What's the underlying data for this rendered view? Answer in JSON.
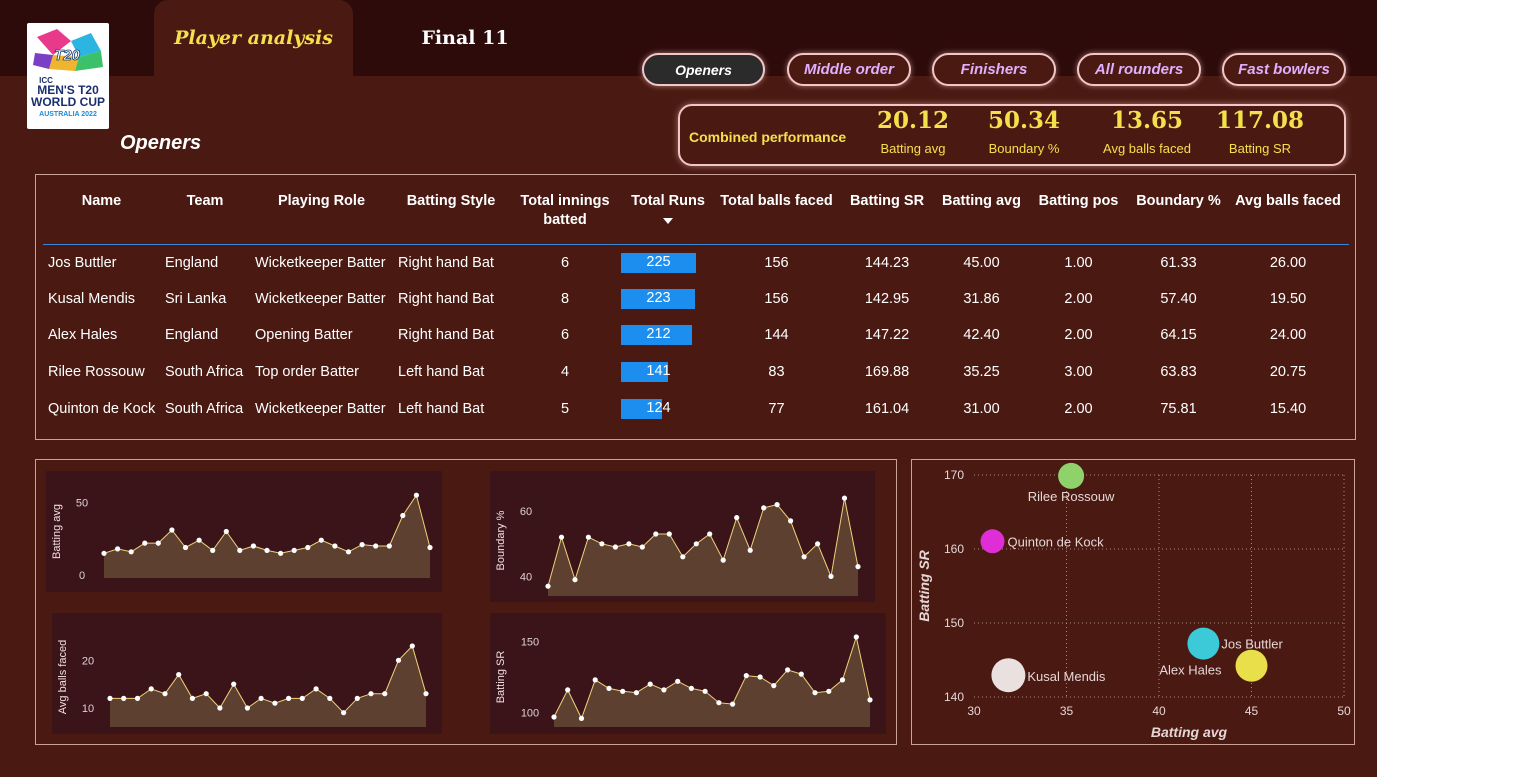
{
  "logo": {
    "line1": "ICC",
    "line2": "MEN'S T20",
    "line3": "WORLD CUP",
    "line4": "AUSTRALIA 2022",
    "mark": "T20"
  },
  "tabs": [
    {
      "label": "Player analysis",
      "active": true
    },
    {
      "label": "Final 11",
      "active": false
    }
  ],
  "role_buttons": [
    {
      "label": "Openers",
      "active": true
    },
    {
      "label": "Middle order",
      "active": false
    },
    {
      "label": "Finishers",
      "active": false
    },
    {
      "label": "All rounders",
      "active": false
    },
    {
      "label": "Fast bowlers",
      "active": false
    }
  ],
  "page_heading": "Openers",
  "combined": {
    "label": "Combined performance",
    "kpis": [
      {
        "value": "20.12",
        "name": "Batting avg"
      },
      {
        "value": "50.34",
        "name": "Boundary %"
      },
      {
        "value": "13.65",
        "name": "Avg balls faced"
      },
      {
        "value": "117.08",
        "name": "Batting SR"
      }
    ]
  },
  "table": {
    "columns": [
      "Name",
      "Team",
      "Playing Role",
      "Batting Style",
      "Total innings batted",
      "Total Runs",
      "Total balls faced",
      "Batting SR",
      "Batting avg",
      "Batting pos",
      "Boundary %",
      "Avg balls faced"
    ],
    "sorted_by": "Total Runs",
    "rows": [
      {
        "name": "Jos Buttler",
        "team": "England",
        "role": "Wicketkeeper Batter",
        "style": "Right hand Bat",
        "innings": "6",
        "runs": "225",
        "runs_value": 225,
        "balls": "156",
        "sr": "144.23",
        "avg": "45.00",
        "pos": "1.00",
        "boundary": "61.33",
        "abf": "26.00"
      },
      {
        "name": "Kusal Mendis",
        "team": "Sri Lanka",
        "role": "Wicketkeeper Batter",
        "style": "Right hand Bat",
        "innings": "8",
        "runs": "223",
        "runs_value": 223,
        "balls": "156",
        "sr": "142.95",
        "avg": "31.86",
        "pos": "2.00",
        "boundary": "57.40",
        "abf": "19.50"
      },
      {
        "name": "Alex Hales",
        "team": "England",
        "role": "Opening Batter",
        "style": "Right hand Bat",
        "innings": "6",
        "runs": "212",
        "runs_value": 212,
        "balls": "144",
        "sr": "147.22",
        "avg": "42.40",
        "pos": "2.00",
        "boundary": "64.15",
        "abf": "24.00"
      },
      {
        "name": "Rilee Rossouw",
        "team": "South Africa",
        "role": "Top order Batter",
        "style": "Left hand Bat",
        "innings": "4",
        "runs": "141",
        "runs_value": 141,
        "balls": "83",
        "sr": "169.88",
        "avg": "35.25",
        "pos": "3.00",
        "boundary": "63.83",
        "abf": "20.75"
      },
      {
        "name": "Quinton de Kock",
        "team": "South Africa",
        "role": "Wicketkeeper Batter",
        "style": "Left hand Bat",
        "innings": "5",
        "runs": "124",
        "runs_value": 124,
        "balls": "77",
        "sr": "161.04",
        "avg": "31.00",
        "pos": "2.00",
        "boundary": "75.81",
        "abf": "15.40"
      }
    ]
  },
  "colors": {
    "background": "#4a1a12",
    "topbar": "#2e0b0b",
    "accent_yellow": "#f4e04d",
    "bar_blue": "#1c8ef0",
    "mini_chart_bg": "#3b1419",
    "area_fill": "#5e4030",
    "line": "#f0d27a",
    "role_text": "#e0b0ff"
  },
  "chart_data": [
    {
      "type": "area",
      "ylabel": "Batting avg",
      "yticks": [
        0,
        50
      ],
      "ylim": [
        -2,
        62
      ],
      "values": [
        15,
        18,
        16,
        22,
        22,
        31,
        19,
        24,
        17,
        30,
        17,
        20,
        17,
        15,
        17,
        19,
        24,
        20,
        16,
        21,
        20,
        20,
        41,
        55,
        19
      ]
    },
    {
      "type": "area",
      "ylabel": "Boundary %",
      "yticks": [
        40,
        60
      ],
      "ylim": [
        34,
        68
      ],
      "values": [
        37,
        52,
        39,
        52,
        50,
        49,
        50,
        49,
        53,
        53,
        46,
        50,
        53,
        45,
        58,
        48,
        61,
        62,
        57,
        46,
        50,
        40,
        64,
        43
      ]
    },
    {
      "type": "area",
      "ylabel": "Avg balls faced",
      "yticks": [
        10,
        20
      ],
      "ylim": [
        6,
        27
      ],
      "values": [
        12,
        12,
        12,
        14,
        13,
        17,
        12,
        13,
        10,
        15,
        10,
        12,
        11,
        12,
        12,
        14,
        12,
        9,
        12,
        13,
        13,
        20,
        23,
        13
      ]
    },
    {
      "type": "area",
      "ylabel": "Batting SR",
      "yticks": [
        100,
        150
      ],
      "ylim": [
        90,
        160
      ],
      "values": [
        97,
        116,
        96,
        123,
        117,
        115,
        114,
        120,
        116,
        122,
        117,
        115,
        107,
        106,
        126,
        125,
        119,
        130,
        127,
        114,
        115,
        123,
        153,
        109
      ]
    },
    {
      "type": "scatter",
      "xlabel": "Batting avg",
      "ylabel": "Batting SR",
      "xlim": [
        30,
        50
      ],
      "ylim": [
        140,
        170
      ],
      "xticks": [
        30,
        35,
        40,
        45,
        50
      ],
      "yticks": [
        140,
        150,
        160,
        170
      ],
      "points": [
        {
          "label": "Rilee Rossouw",
          "x": 35.25,
          "y": 169.88,
          "color": "#8fd16a"
        },
        {
          "label": "Quinton de Kock",
          "x": 31.0,
          "y": 161.04,
          "color": "#e02ed6"
        },
        {
          "label": "Jos Buttler",
          "x": 42.4,
          "y": 147.22,
          "color": "#3ccad8"
        },
        {
          "label": "Alex Hales",
          "x": 45.0,
          "y": 144.23,
          "color": "#e9df4a"
        },
        {
          "label": "Kusal Mendis",
          "x": 31.86,
          "y": 142.95,
          "color": "#ebe0e0"
        }
      ]
    }
  ]
}
